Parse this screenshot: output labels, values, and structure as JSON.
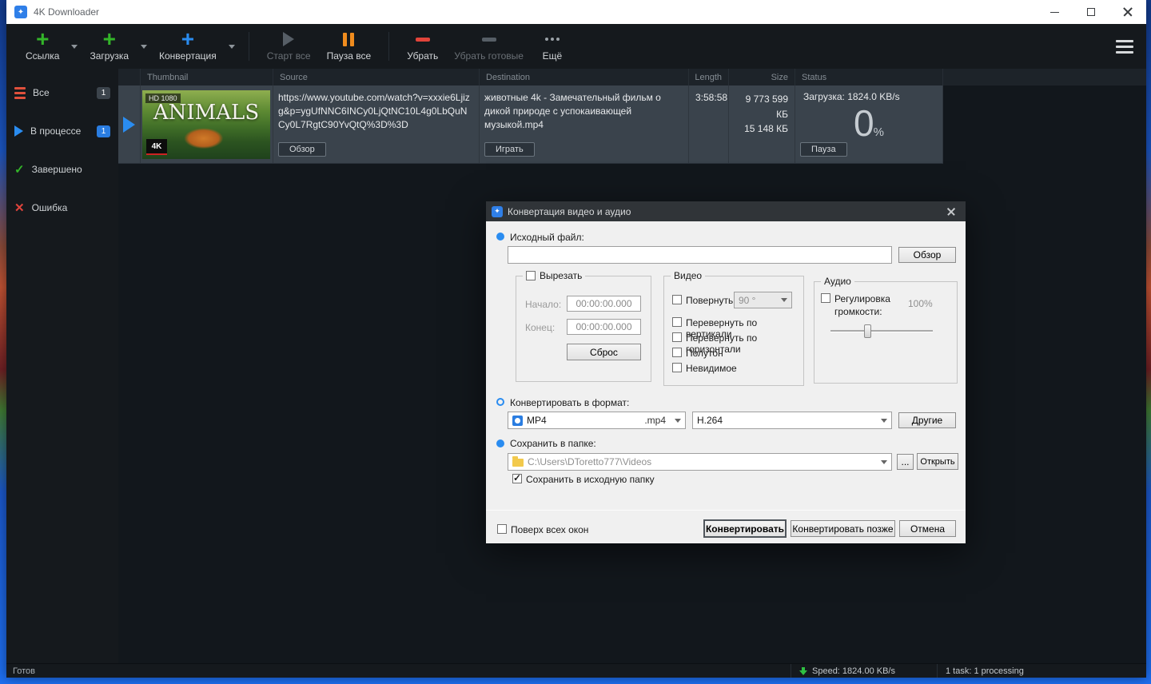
{
  "window": {
    "title": "4K Downloader"
  },
  "icons": {
    "app_glyph": "✦",
    "check": "✓",
    "cross": "✕"
  },
  "toolbar": {
    "link": "Ссылка",
    "download": "Загрузка",
    "convert": "Конвертация",
    "start_all": "Старт все",
    "pause_all": "Пауза все",
    "remove": "Убрать",
    "remove_finished": "Убрать готовые",
    "more": "Ещё"
  },
  "sidebar": {
    "items": [
      {
        "label": "Все",
        "badge": "1"
      },
      {
        "label": "В процессе",
        "badge": "1"
      },
      {
        "label": "Завершено"
      },
      {
        "label": "Ошибка"
      }
    ]
  },
  "table": {
    "headers": [
      "Thumbnail",
      "Source",
      "Destination",
      "Length",
      "Size",
      "Status"
    ],
    "row": {
      "thumb_quality": "HD 1080",
      "thumb_title": "ANIMALS",
      "thumb_logo": "4K",
      "source_url": "https://www.youtube.com/watch?v=xxxie6Ljizg&p=ygUfNNC6INCy0LjQtNC10L4g0LbQuNCy0L7RgtC90YvQtQ%3D%3D",
      "source_button": "Обзор",
      "destination": "животные 4k - Замечательный фильм о дикой природе с успокаивающей музыкой.mp4",
      "destination_button": "Играть",
      "length": "3:58:58",
      "size_total": "9 773 599 КБ",
      "size_done": "15 148 КБ",
      "status_text": "Загрузка: 1824.0 KB/s",
      "progress_value": "0",
      "progress_unit": "%",
      "status_button": "Пауза"
    }
  },
  "dialog": {
    "title": "Конвертация видео и аудио",
    "source_file_label": "Исходный файл:",
    "browse_button": "Обзор",
    "cut_group": {
      "label": "Вырезать",
      "start_label": "Начало:",
      "start_value": "00:00:00.000",
      "end_label": "Конец:",
      "end_value": "00:00:00.000",
      "reset_button": "Сброс"
    },
    "video_group": {
      "label": "Видео",
      "rotate_label": "Повернуть:",
      "rotate_value": "90 °",
      "flip_v": "Перевернуть по вертикали",
      "flip_h": "Перевернуть по горизонтали",
      "halftone": "Полутон",
      "invisible": "Невидимое"
    },
    "audio_group": {
      "label": "Аудио",
      "volume_label": "Регулировка громкости:",
      "volume_value": "100%"
    },
    "format_label": "Конвертировать в формат:",
    "format_value": "MP4",
    "format_ext": ".mp4",
    "codec_value": "H.264",
    "other_button": "Другие",
    "folder_label": "Сохранить в папке:",
    "folder_value": "C:\\Users\\DToretto777\\Videos",
    "dots_button": "...",
    "open_button": "Открыть",
    "save_source_checkbox": "Сохранить в исходную папку",
    "on_top_checkbox": "Поверх всех окон",
    "convert_button": "Конвертировать",
    "convert_later_button": "Конвертировать позже",
    "cancel_button": "Отмена"
  },
  "statusbar": {
    "ready": "Готов",
    "speed": "Speed: 1824.00 KB/s",
    "tasks": "1 task: 1 processing"
  }
}
